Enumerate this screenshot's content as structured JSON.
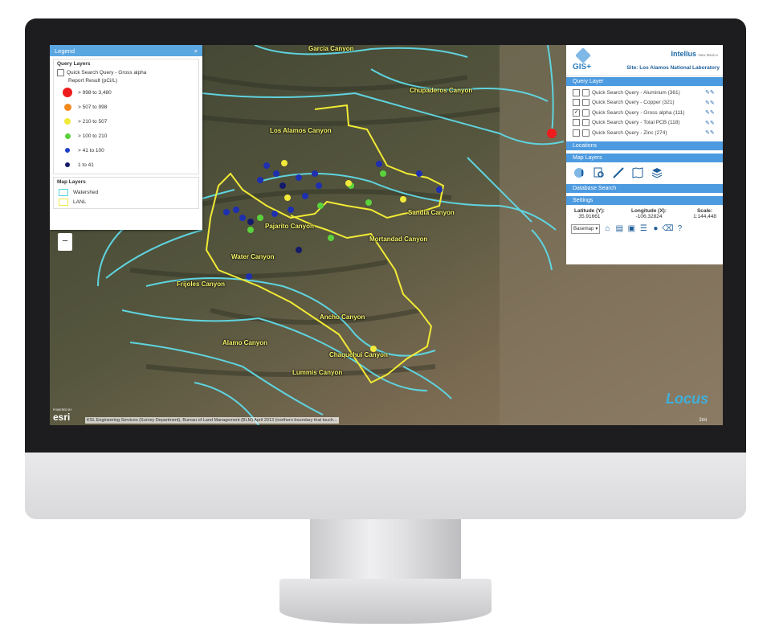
{
  "legend": {
    "title": "Legend",
    "close": "×",
    "query_layers_title": "Query Layers",
    "query_name": "Quick Search Query - Gross alpha",
    "report_result": "Report Result (pCi/L)",
    "items": [
      {
        "label": "> 998 to 3,480",
        "color": "#ee1c1c"
      },
      {
        "label": "> 507 to 998",
        "color": "#f08a1e"
      },
      {
        "label": "> 210 to 507",
        "color": "#f1ea3a"
      },
      {
        "label": "> 100 to 210",
        "color": "#5ad23b"
      },
      {
        "label": "> 41 to 100",
        "color": "#1e3fc8"
      },
      {
        "label": "1 to 41",
        "color": "#141a6a"
      }
    ],
    "map_layers_title": "Map Layers",
    "map_layers": [
      {
        "label": "Watershed",
        "color": "#58d3e0"
      },
      {
        "label": "LANL",
        "color": "#f0e948"
      }
    ]
  },
  "zoom_label": "−",
  "panel": {
    "gis_label": "GIS+",
    "brand": "Intellus",
    "brand_sub": "New Mexico",
    "site": "Site: Los Alamos National Laboratory",
    "query_layer_title": "Query Layer",
    "queries": [
      {
        "label": "Quick Search Query - Aluminum (361)",
        "checked": false
      },
      {
        "label": "Quick Search Query - Copper (321)",
        "checked": false
      },
      {
        "label": "Quick Search Query - Gross alpha (111)",
        "checked": true
      },
      {
        "label": "Quick Search Query - Total PCB (118)",
        "checked": false
      },
      {
        "label": "Quick Search Query - Zinc (274)",
        "checked": false
      }
    ],
    "locations_title": "Locations",
    "map_layers_title": "Map Layers",
    "database_search_title": "Database Search",
    "settings_title": "Settings",
    "latitude_label": "Latitude (Y):",
    "latitude_value": "35.91661",
    "longitude_label": "Longitude (X):",
    "longitude_value": "-106.32824",
    "scale_label": "Scale:",
    "scale_value": "1:144,448",
    "basemap_label": "Basemap",
    "help": "?"
  },
  "map": {
    "canyons": [
      {
        "label": "Garcia Canyon"
      },
      {
        "label": "Chupaderos Canyon"
      },
      {
        "label": "Los Alamos Canyon"
      },
      {
        "label": "Sandia Canyon"
      },
      {
        "label": "Pajarito Canyon"
      },
      {
        "label": "Mortandad Canyon"
      },
      {
        "label": "Water Canyon"
      },
      {
        "label": "Frijoles Canyon"
      },
      {
        "label": "Ancho Canyon"
      },
      {
        "label": "Alamo Canyon"
      },
      {
        "label": "Chaquehui Canyon"
      },
      {
        "label": "Lummis Canyon"
      }
    ],
    "esri_powered": "POWERED BY",
    "esri": "esri",
    "attribution": "KSL Engineering Services (Survey Department), Bureau of Land Management (BLM) April 2013 (northern boundary that touch...",
    "locus": "Locus",
    "scale_text": "2mi"
  }
}
